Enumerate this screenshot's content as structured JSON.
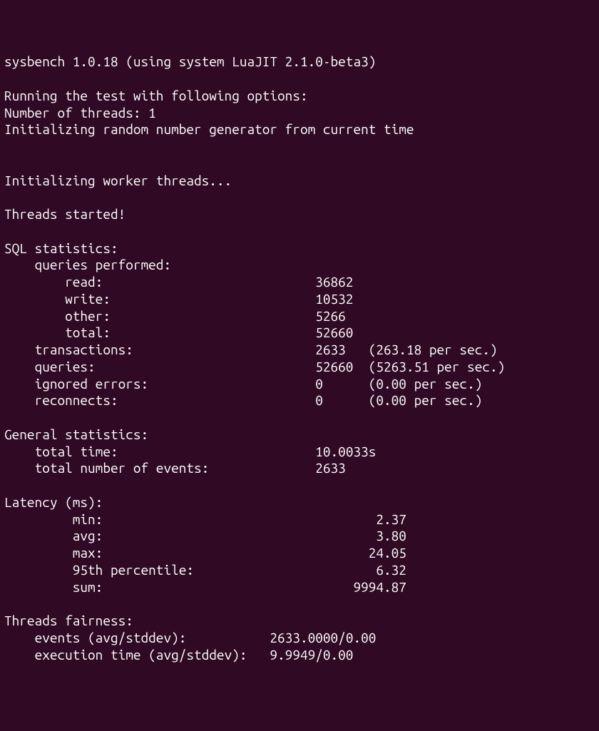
{
  "header": {
    "version_line": "sysbench 1.0.18 (using system LuaJIT 2.1.0-beta3)",
    "running_line": "Running the test with following options:",
    "threads_line": "Number of threads: 1",
    "rng_line": "Initializing random number generator from current time",
    "init_workers": "Initializing worker threads...",
    "threads_started": "Threads started!"
  },
  "sql": {
    "title": "SQL statistics:",
    "queries_performed": "queries performed:",
    "read_label": "read:",
    "read_value": "36862",
    "write_label": "write:",
    "write_value": "10532",
    "other_label": "other:",
    "other_value": "5266",
    "total_label": "total:",
    "total_value": "52660",
    "transactions_label": "transactions:",
    "transactions_value": "2633",
    "transactions_rate": "(263.18 per sec.)",
    "queries_label": "queries:",
    "queries_value": "52660",
    "queries_rate": "(5263.51 per sec.)",
    "ignored_label": "ignored errors:",
    "ignored_value": "0",
    "ignored_rate": "(0.00 per sec.)",
    "reconnects_label": "reconnects:",
    "reconnects_value": "0",
    "reconnects_rate": "(0.00 per sec.)"
  },
  "general": {
    "title": "General statistics:",
    "total_time_label": "total time:",
    "total_time_value": "10.0033s",
    "events_label": "total number of events:",
    "events_value": "2633"
  },
  "latency": {
    "title": "Latency (ms):",
    "min_label": "min:",
    "min_value": "2.37",
    "avg_label": "avg:",
    "avg_value": "3.80",
    "max_label": "max:",
    "max_value": "24.05",
    "p95_label": "95th percentile:",
    "p95_value": "6.32",
    "sum_label": "sum:",
    "sum_value": "9994.87"
  },
  "fairness": {
    "title": "Threads fairness:",
    "events_label": "events (avg/stddev):",
    "events_value": "2633.0000/0.00",
    "exec_label": "execution time (avg/stddev):",
    "exec_value": "9.9949/0.00"
  }
}
